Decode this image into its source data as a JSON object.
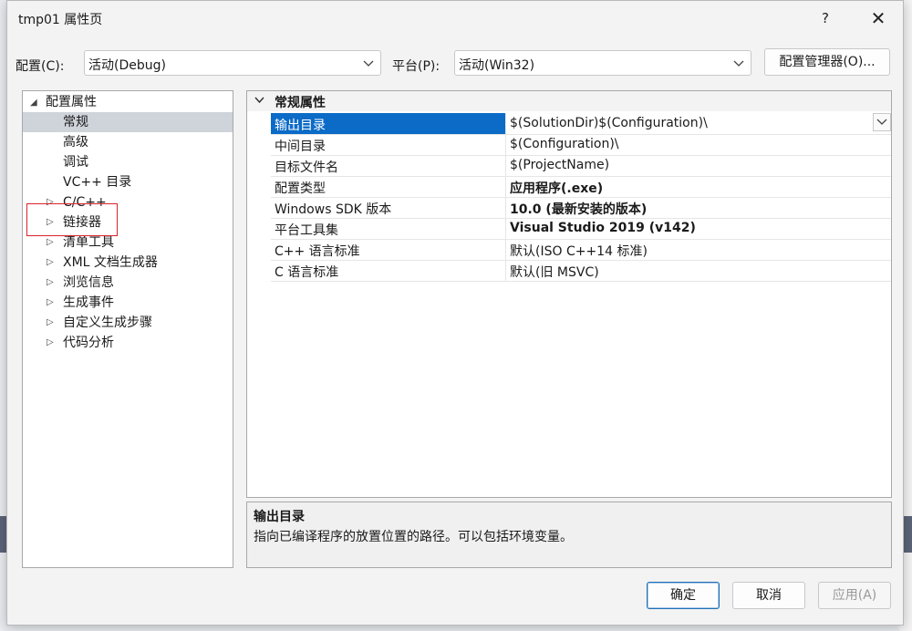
{
  "window": {
    "title": "tmp01 属性页",
    "help_glyph": "?",
    "close_glyph": "✕"
  },
  "config": {
    "label": "配置(C):",
    "value": "活动(Debug)"
  },
  "platform": {
    "label": "平台(P):",
    "value": "活动(Win32)"
  },
  "manager_button": "配置管理器(O)...",
  "tree": {
    "root": "配置属性",
    "items": [
      {
        "label": "常规",
        "selected": true,
        "expandable": false
      },
      {
        "label": "高级",
        "expandable": false
      },
      {
        "label": "调试",
        "expandable": false
      },
      {
        "label": "VC++ 目录",
        "expandable": false
      },
      {
        "label": "C/C++",
        "expandable": true
      },
      {
        "label": "链接器",
        "expandable": true,
        "highlighted": true
      },
      {
        "label": "清单工具",
        "expandable": true
      },
      {
        "label": "XML 文档生成器",
        "expandable": true
      },
      {
        "label": "浏览信息",
        "expandable": true
      },
      {
        "label": "生成事件",
        "expandable": true
      },
      {
        "label": "自定义生成步骤",
        "expandable": true
      },
      {
        "label": "代码分析",
        "expandable": true
      }
    ]
  },
  "grid": {
    "section": "常规属性",
    "rows": [
      {
        "name": "输出目录",
        "value": "$(SolutionDir)$(Configuration)\\",
        "bold": false,
        "selected": true
      },
      {
        "name": "中间目录",
        "value": "$(Configuration)\\",
        "bold": false
      },
      {
        "name": "目标文件名",
        "value": "$(ProjectName)",
        "bold": false
      },
      {
        "name": "配置类型",
        "value": "应用程序(.exe)",
        "bold": true
      },
      {
        "name": "Windows SDK 版本",
        "value": "10.0 (最新安装的版本)",
        "bold": true
      },
      {
        "name": "平台工具集",
        "value": "Visual Studio 2019 (v142)",
        "bold": true
      },
      {
        "name": "C++ 语言标准",
        "value": "默认(ISO C++14 标准)",
        "bold": false
      },
      {
        "name": "C 语言标准",
        "value": "默认(旧 MSVC)",
        "bold": false
      }
    ]
  },
  "description": {
    "heading": "输出目录",
    "text": "指向已编译程序的放置位置的路径。可以包括环境变量。"
  },
  "buttons": {
    "ok": "确定",
    "cancel": "取消",
    "apply": "应用(A)"
  },
  "colors": {
    "selection": "#0b6bc7",
    "highlight_box": "#d9242b"
  }
}
